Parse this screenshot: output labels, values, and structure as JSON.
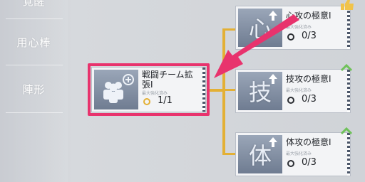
{
  "sidebar": {
    "items": [
      {
        "label": "覚醒"
      },
      {
        "label": "用心棒"
      },
      {
        "label": "陣形"
      }
    ]
  },
  "nodes": {
    "expand": {
      "title_line1": "戦闘チーム拡",
      "title_line2": "張Ⅰ",
      "sub": "最大強化済み",
      "count": "1/1"
    },
    "heart": {
      "kanji": "心",
      "title": "心攻の極意Ⅰ",
      "sub": "最大強化済み",
      "count": "0/3"
    },
    "skill": {
      "kanji": "技",
      "title": "技攻の極意Ⅰ",
      "sub": "最大強化済み",
      "count": "0/3"
    },
    "body": {
      "kanji": "体",
      "title": "体攻の極意Ⅰ",
      "sub": "最大強化済み",
      "count": "0/3"
    }
  },
  "colors": {
    "highlight": "#e8336d",
    "connector": "#e3b035",
    "ring_done": "#e3b035",
    "ring_todo": "#2b2e33",
    "upgrade_badge": "#6fc25a"
  }
}
